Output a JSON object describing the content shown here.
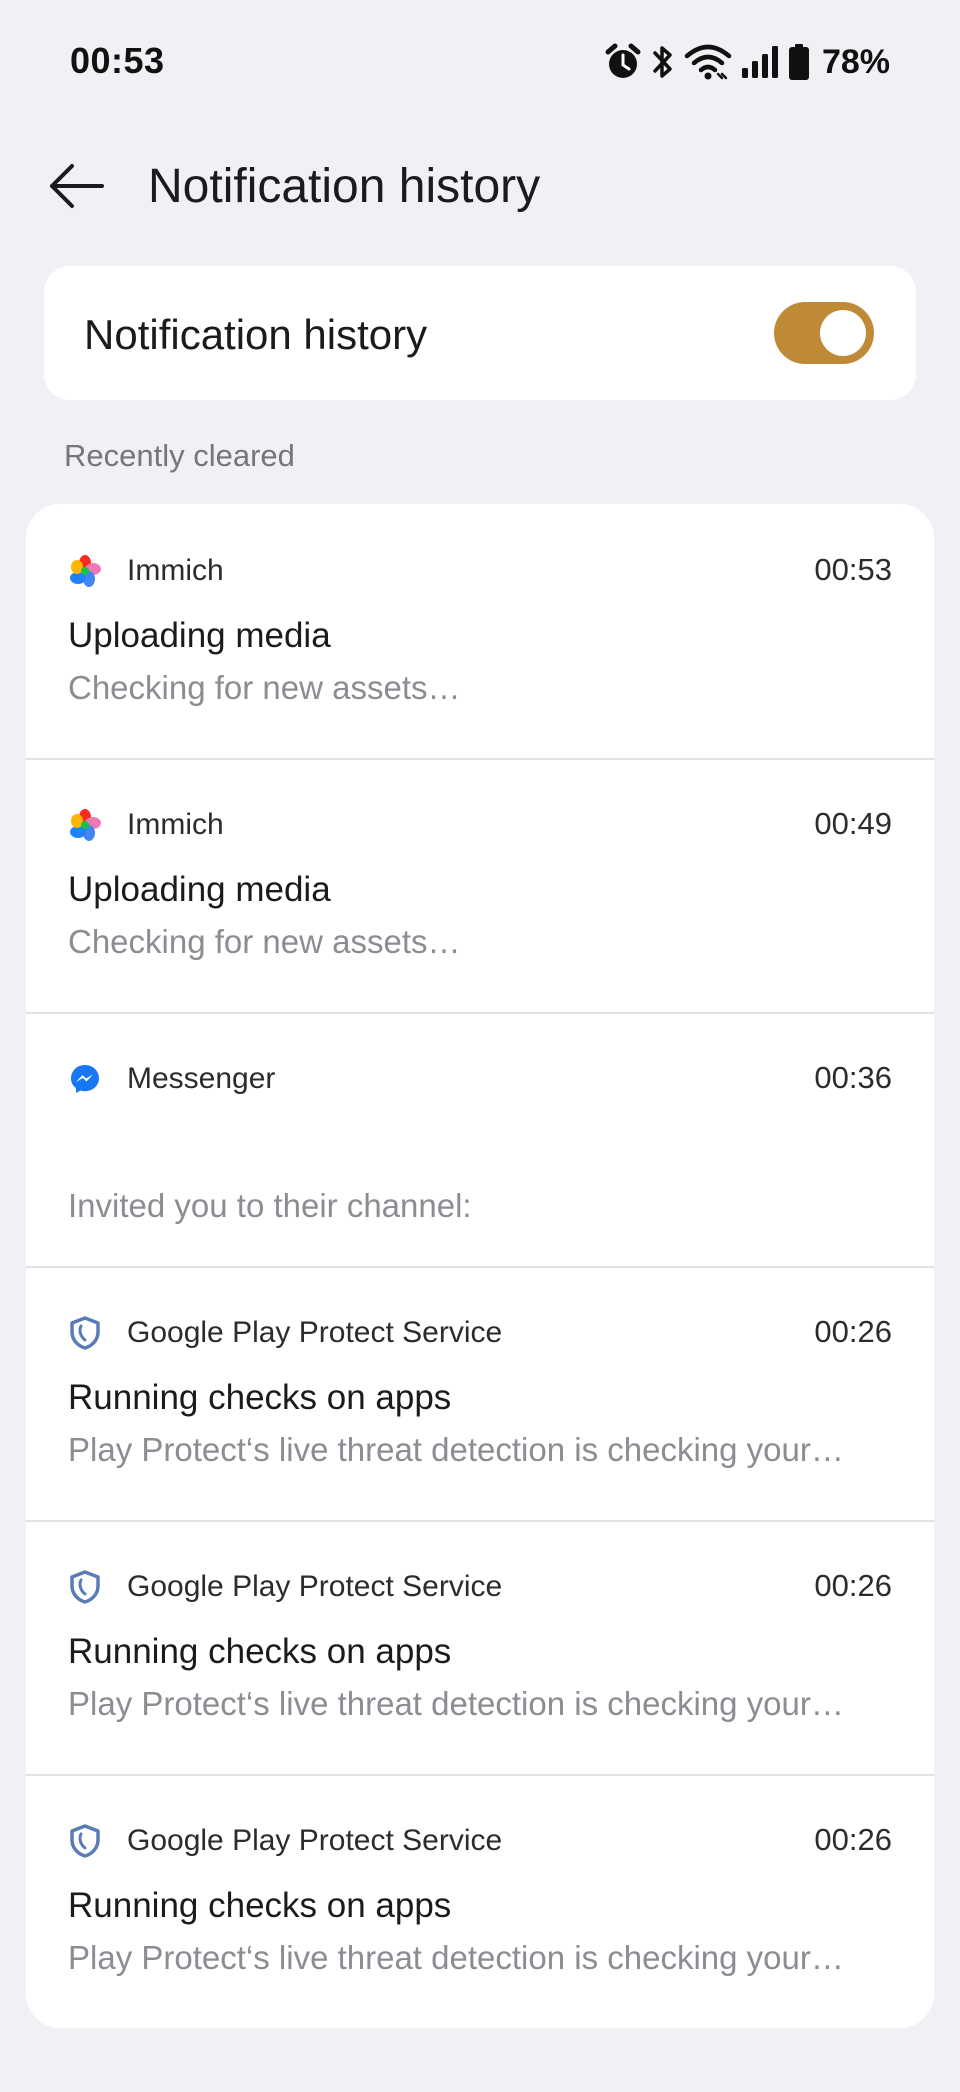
{
  "status_bar": {
    "time": "00:53",
    "battery_percent": "78%",
    "icons": [
      "alarm-icon",
      "bluetooth-icon",
      "wifi-icon",
      "cellular-signal-icon",
      "battery-icon"
    ]
  },
  "header": {
    "back_icon": "arrow-left-icon",
    "title": "Notification history"
  },
  "toggle": {
    "label": "Notification history",
    "enabled": true,
    "accent": "#bf8a37"
  },
  "section": {
    "label": "Recently cleared"
  },
  "entries": [
    {
      "app": "Immich",
      "icon": "immich-pinwheel-icon",
      "time": "00:53",
      "title": "Uploading media",
      "text": "Checking for new assets…"
    },
    {
      "app": "Immich",
      "icon": "immich-pinwheel-icon",
      "time": "00:49",
      "title": "Uploading media",
      "text": "Checking for new assets…"
    },
    {
      "app": "Messenger",
      "icon": "messenger-icon",
      "time": "00:36",
      "title": "",
      "text": "Invited you to their channel:"
    },
    {
      "app": "Google Play Protect Service",
      "icon": "play-protect-shield-icon",
      "time": "00:26",
      "title": "Running checks on apps",
      "text": "Play Protect‘s live threat detection is checking your…"
    },
    {
      "app": "Google Play Protect Service",
      "icon": "play-protect-shield-icon",
      "time": "00:26",
      "title": "Running checks on apps",
      "text": "Play Protect‘s live threat detection is checking your…"
    },
    {
      "app": "Google Play Protect Service",
      "icon": "play-protect-shield-icon",
      "time": "00:26",
      "title": "Running checks on apps",
      "text": "Play Protect‘s live threat detection is checking your…"
    }
  ]
}
